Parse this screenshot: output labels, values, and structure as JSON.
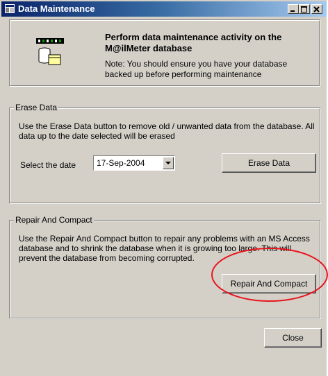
{
  "window": {
    "title": "Data Maintenance"
  },
  "header": {
    "title": "Perform data maintenance activity on the M@ilMeter database",
    "note": "Note: You should ensure you have your database backed up before performing maintenance"
  },
  "erase": {
    "group_label": "Erase Data",
    "description": "Use the Erase Data button to remove old / unwanted data from the database. All data up to the date selected will be erased",
    "date_label": "Select the date",
    "date_value": "17-Sep-2004",
    "button_label": "Erase Data"
  },
  "repair": {
    "group_label": "Repair And Compact",
    "description": "Use the Repair And Compact button to repair any problems with an MS Access database and to shrink the database when it is growing too large. This will prevent the database from becoming corrupted.",
    "button_label": "Repair And Compact"
  },
  "footer": {
    "close_label": "Close"
  },
  "colors": {
    "annotation": "#e8141c",
    "titlebar_start": "#0a246a",
    "titlebar_end": "#a6caf0"
  }
}
